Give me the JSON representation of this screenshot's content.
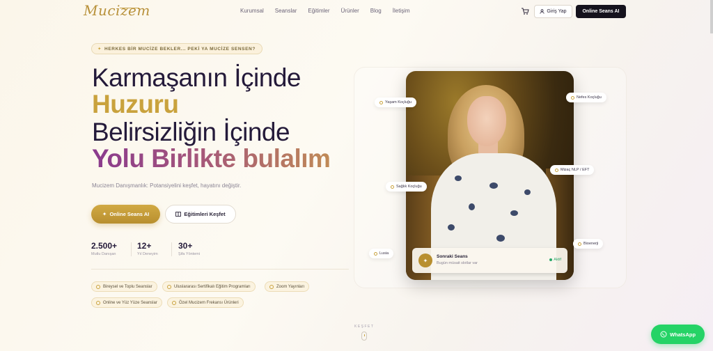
{
  "brand": {
    "logo_text": "Mucizem"
  },
  "nav": {
    "links": [
      "Kurumsal",
      "Seanslar",
      "Eğitimler",
      "Ürünler",
      "Blog",
      "İletişim"
    ],
    "login_label": "Giriş Yap",
    "cta_label": "Online Seans AI"
  },
  "hero": {
    "tagline": "HERKES BİR MUCİZE BEKLER... PEKİ YA MUCİZE SENSEN?",
    "headline": [
      "Karmaşanın İçinde",
      "Huzuru",
      "Belirsizliğin İçinde",
      "Yolu Birlikte bulalım"
    ],
    "subtitle": "Mucizem Danışmanlık: Potansiyelini keşfet, hayatını değiştir.",
    "primary_btn": "Online Seans AI",
    "secondary_btn": "Eğitimleri Keşfet",
    "stats": [
      {
        "value": "2.500+",
        "label": "Mutlu Danışan"
      },
      {
        "value": "12+",
        "label": "Yıl Deneyim"
      },
      {
        "value": "30+",
        "label": "Şifa Yöntemi"
      }
    ],
    "features": [
      "Bireysel ve Toplu Seanslar",
      "Uluslararası Sertifikalı Eğitim Programları",
      "Zoom Yayınları",
      "Online ve Yüz Yüze Seanslar",
      "Özel Mucizem Frekansı Ürünleri"
    ]
  },
  "visual": {
    "pills": [
      "Yaşam Koçluğu",
      "Nefes Koçluğu",
      "Mizaç NLP / EFT",
      "Sağlık Koçluğu",
      "Bioenerji",
      "Lusia"
    ],
    "session": {
      "title": "Sonraki Seans",
      "subtitle": "Bugün müsait slotlar var",
      "status": "Aktif"
    }
  },
  "scroll_hint": "KEŞFET",
  "whatsapp_label": "WhatsApp",
  "colors": {
    "gold": "#c9a23d",
    "dark": "#15121d",
    "purple": "#8a3a8e",
    "green": "#25d366"
  }
}
